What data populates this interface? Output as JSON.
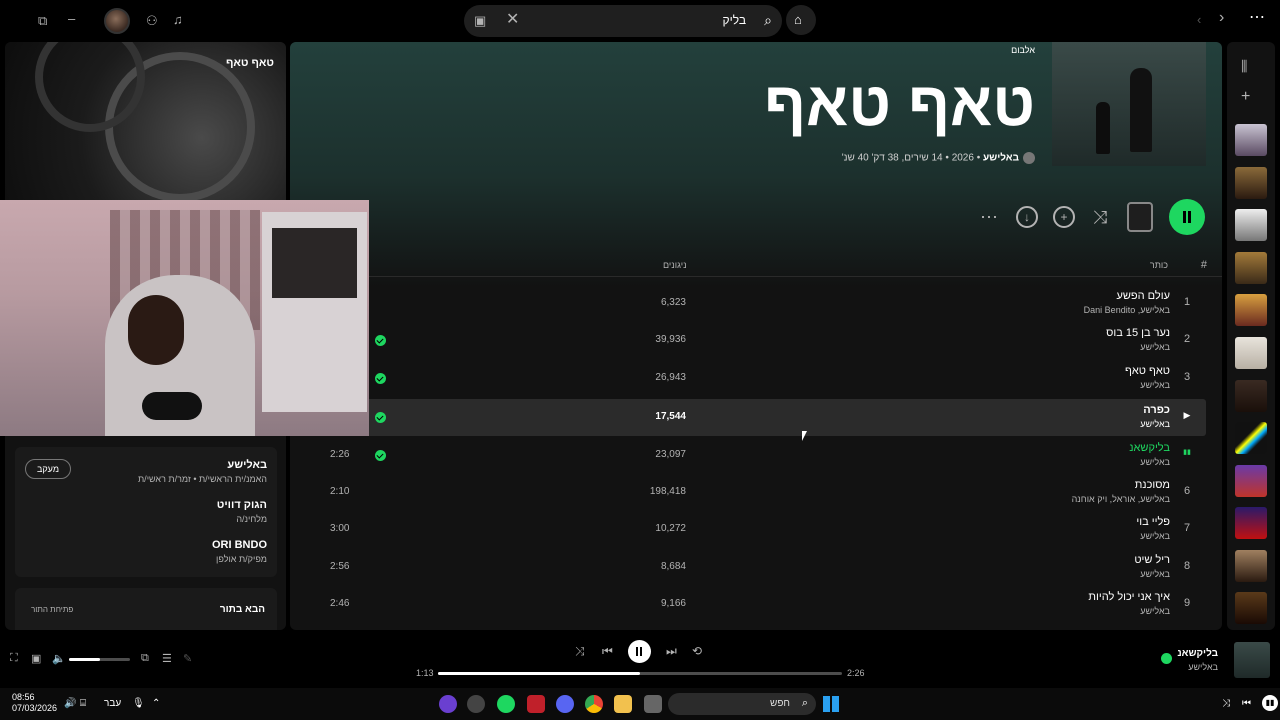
{
  "topbar": {
    "search_value": "בליק",
    "window_controls": [
      "restore-icon",
      "minimize-icon"
    ],
    "icons": [
      "friends-icon",
      "bell-icon",
      "home-icon",
      "browse-icon",
      "clear-icon",
      "back-icon",
      "forward-icon",
      "more-icon"
    ]
  },
  "now_playing_panel": {
    "title": "טאף טאף",
    "credits": [
      {
        "name": "באלישע",
        "role": "האמנ/ית הראשי/ת • זמר/ת ראשי/ת",
        "action": "מעקב"
      },
      {
        "name": "הגוק דוויט",
        "role": "מלחינ/ה"
      },
      {
        "name": "ORI BNDO",
        "role": "מפיק/ת אולפן"
      }
    ],
    "next_in_queue": "הבא בתור",
    "open_queue": "פתיחת התור"
  },
  "album": {
    "type": "אלבום",
    "title": "טאף טאף",
    "artist": "באלישע",
    "meta": " • 2026 • 14 שירים, 38 דק' 40 שנ'"
  },
  "table": {
    "hash": "#",
    "title_header": "כותר",
    "plays_header": "ניגונים",
    "tracks": [
      {
        "num": "1",
        "name": "עולם הפשע",
        "artist": "באלישע, Dani Bendito",
        "plays": "6,323",
        "duration": "",
        "saved": false
      },
      {
        "num": "2",
        "name": "נער בן 15 בוס",
        "artist": "באלישע",
        "plays": "39,936",
        "duration": "",
        "saved": true
      },
      {
        "num": "3",
        "name": "טאף טאף",
        "artist": "באלישע",
        "plays": "26,943",
        "duration": "",
        "saved": true
      },
      {
        "num": "▶",
        "name": "כפרה",
        "artist": "באלישע",
        "plays": "17,544",
        "duration": "",
        "saved": true
      },
      {
        "num": "▮▮",
        "name": "בליקשאנ",
        "artist": "באלישע",
        "plays": "23,097",
        "duration": "2:26",
        "saved": true
      },
      {
        "num": "6",
        "name": "מסוכנת",
        "artist": "באלישע, אוראל, ויק אוחנה",
        "plays": "198,418",
        "duration": "2:10",
        "saved": false
      },
      {
        "num": "7",
        "name": "פליי בוי",
        "artist": "באלישע",
        "plays": "10,272",
        "duration": "3:00",
        "saved": false
      },
      {
        "num": "8",
        "name": "ריל שיט",
        "artist": "באלישע",
        "plays": "8,684",
        "duration": "2:56",
        "saved": false
      },
      {
        "num": "9",
        "name": "איך אני יכול להיות",
        "artist": "באלישע",
        "plays": "9,166",
        "duration": "2:46",
        "saved": false
      }
    ]
  },
  "player": {
    "track": "בליקשאנ",
    "artist": "באלישע",
    "elapsed": "1:13",
    "total": "2:26",
    "progress": 0.5,
    "volume": 0.5
  },
  "taskbar": {
    "time": "08:56",
    "date": "07/03/2026",
    "lang": "עבר",
    "search_placeholder": "חפש"
  },
  "colors": {
    "accent": "#1ed760",
    "header": "#23403c"
  }
}
